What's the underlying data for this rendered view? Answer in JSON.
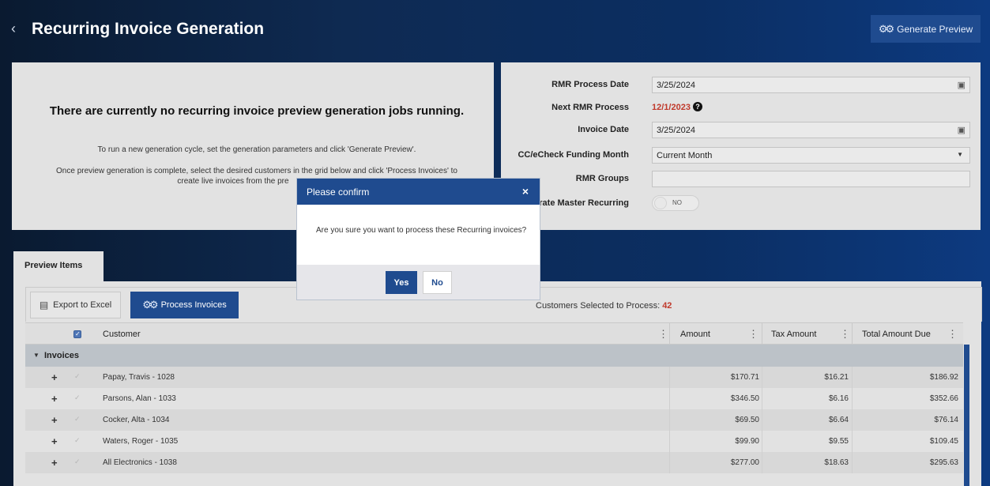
{
  "header": {
    "back_icon": "chevron-left-icon",
    "title": "Recurring Invoice Generation",
    "generate_preview_label": "Generate Preview"
  },
  "status_panel": {
    "title": "There are currently no recurring invoice preview generation jobs running.",
    "line1": "To run a new generation cycle, set the generation parameters and click 'Generate Preview'.",
    "line2": "Once preview generation is complete, select the desired customers in the grid below and click 'Process Invoices' to",
    "line3": "create live invoices from the pre"
  },
  "params": {
    "rmr_process_date_label": "RMR Process Date",
    "rmr_process_date_value": "3/25/2024",
    "next_rmr_process_label": "Next RMR Process",
    "next_rmr_process_value": "12/1/2023",
    "invoice_date_label": "Invoice Date",
    "invoice_date_value": "3/25/2024",
    "funding_month_label": "CC/eCheck Funding Month",
    "funding_month_value": "Current Month",
    "rmr_groups_label": "RMR Groups",
    "rmr_groups_value": "",
    "master_recurring_label": "rate Master Recurring",
    "master_recurring_toggle": "NO"
  },
  "tabs": {
    "preview_items": "Preview Items"
  },
  "toolbar": {
    "export_label": "Export to Excel",
    "process_label": "Process Invoices",
    "selected_label": "Customers Selected to Process:",
    "selected_count": "42"
  },
  "grid": {
    "columns": {
      "customer": "Customer",
      "amount": "Amount",
      "tax": "Tax Amount",
      "total": "Total Amount Due"
    },
    "group": "Invoices",
    "rows": [
      {
        "customer": "Papay, Travis - 1028",
        "amount": "$170.71",
        "tax": "$16.21",
        "total": "$186.92"
      },
      {
        "customer": "Parsons, Alan - 1033",
        "amount": "$346.50",
        "tax": "$6.16",
        "total": "$352.66"
      },
      {
        "customer": "Cocker, Alta - 1034",
        "amount": "$69.50",
        "tax": "$6.64",
        "total": "$76.14"
      },
      {
        "customer": "Waters, Roger - 1035",
        "amount": "$99.90",
        "tax": "$9.55",
        "total": "$109.45"
      },
      {
        "customer": "All Electronics - 1038",
        "amount": "$277.00",
        "tax": "$18.63",
        "total": "$295.63"
      }
    ]
  },
  "dialog": {
    "title": "Please confirm",
    "message": "Are you sure you want to process these Recurring invoices?",
    "yes_label": "Yes",
    "no_label": "No"
  }
}
